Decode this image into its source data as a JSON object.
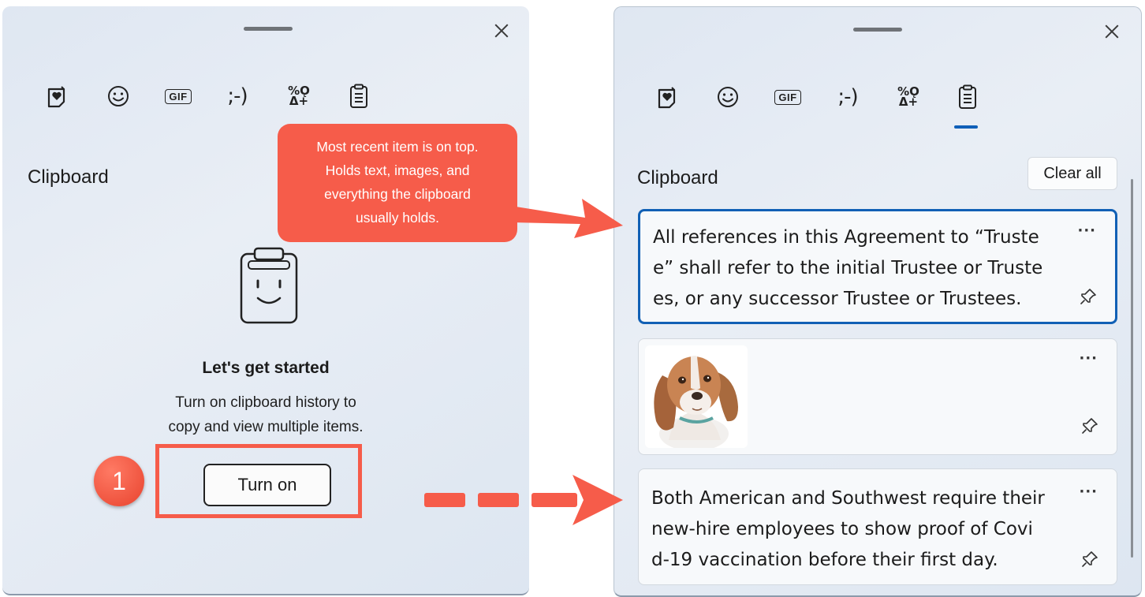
{
  "left_panel": {
    "tabs": [
      "favorites-icon",
      "emoji-icon",
      "gif-icon",
      "kaomoji-icon",
      "symbols-icon",
      "clipboard-icon"
    ],
    "gif_label": "GIF",
    "kaomoji_label": ";-)",
    "symbols_top": "%Ǫ",
    "symbols_bottom": "Δ+",
    "section_title": "Clipboard",
    "empty_state": {
      "title": "Let's get started",
      "line1": "Turn on clipboard history to",
      "line2": "copy and view multiple items."
    },
    "turn_on_label": "Turn on"
  },
  "right_panel": {
    "gif_label": "GIF",
    "kaomoji_label": ";-)",
    "symbols_top": "%Ǫ",
    "symbols_bottom": "Δ+",
    "section_title": "Clipboard",
    "clear_all_label": "Clear all",
    "items": [
      {
        "line1": "All references in this Agreement to “Truste",
        "line2": "e” shall refer to the initial Trustee or Truste",
        "line3": "es, or any successor Trustee or Trustees.",
        "selected": true
      },
      {
        "type": "image",
        "subject": "beagle puppy"
      },
      {
        "line1": "Both American and Southwest require their",
        "line2": "new-hire employees to show proof of Covi",
        "line3": "d-19 vaccination before their first day."
      }
    ],
    "more_label": "···"
  },
  "annotations": {
    "callout": {
      "line1": "Most recent item is on top.",
      "line2": "Holds text, images, and",
      "line3": "everything the clipboard",
      "line4": "usually holds."
    },
    "step_number": "1",
    "accent_color": "#f65c4a"
  }
}
